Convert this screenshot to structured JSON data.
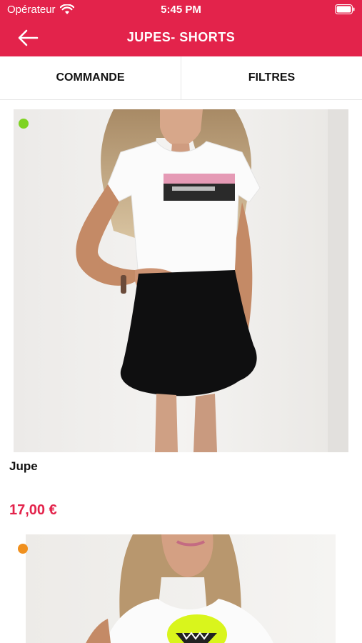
{
  "status_bar": {
    "carrier": "Opérateur",
    "time": "5:45 PM"
  },
  "header": {
    "title": "JUPES- SHORTS",
    "back_icon": "arrow-left-icon",
    "color": "#e3234b"
  },
  "tabs": [
    {
      "label": "COMMANDE"
    },
    {
      "label": "FILTRES"
    }
  ],
  "products": [
    {
      "name": "Jupe",
      "price": "17,00 €",
      "availability_color": "#7ed321",
      "image": "woman in white t-shirt with black flared mini skirt"
    },
    {
      "name": "",
      "price": "",
      "availability_color": "#f0901e",
      "image": "woman in white t-shirt with yellow lips print"
    }
  ],
  "colors": {
    "accent": "#e3234b",
    "available": "#7ed321",
    "limited": "#f0901e"
  }
}
